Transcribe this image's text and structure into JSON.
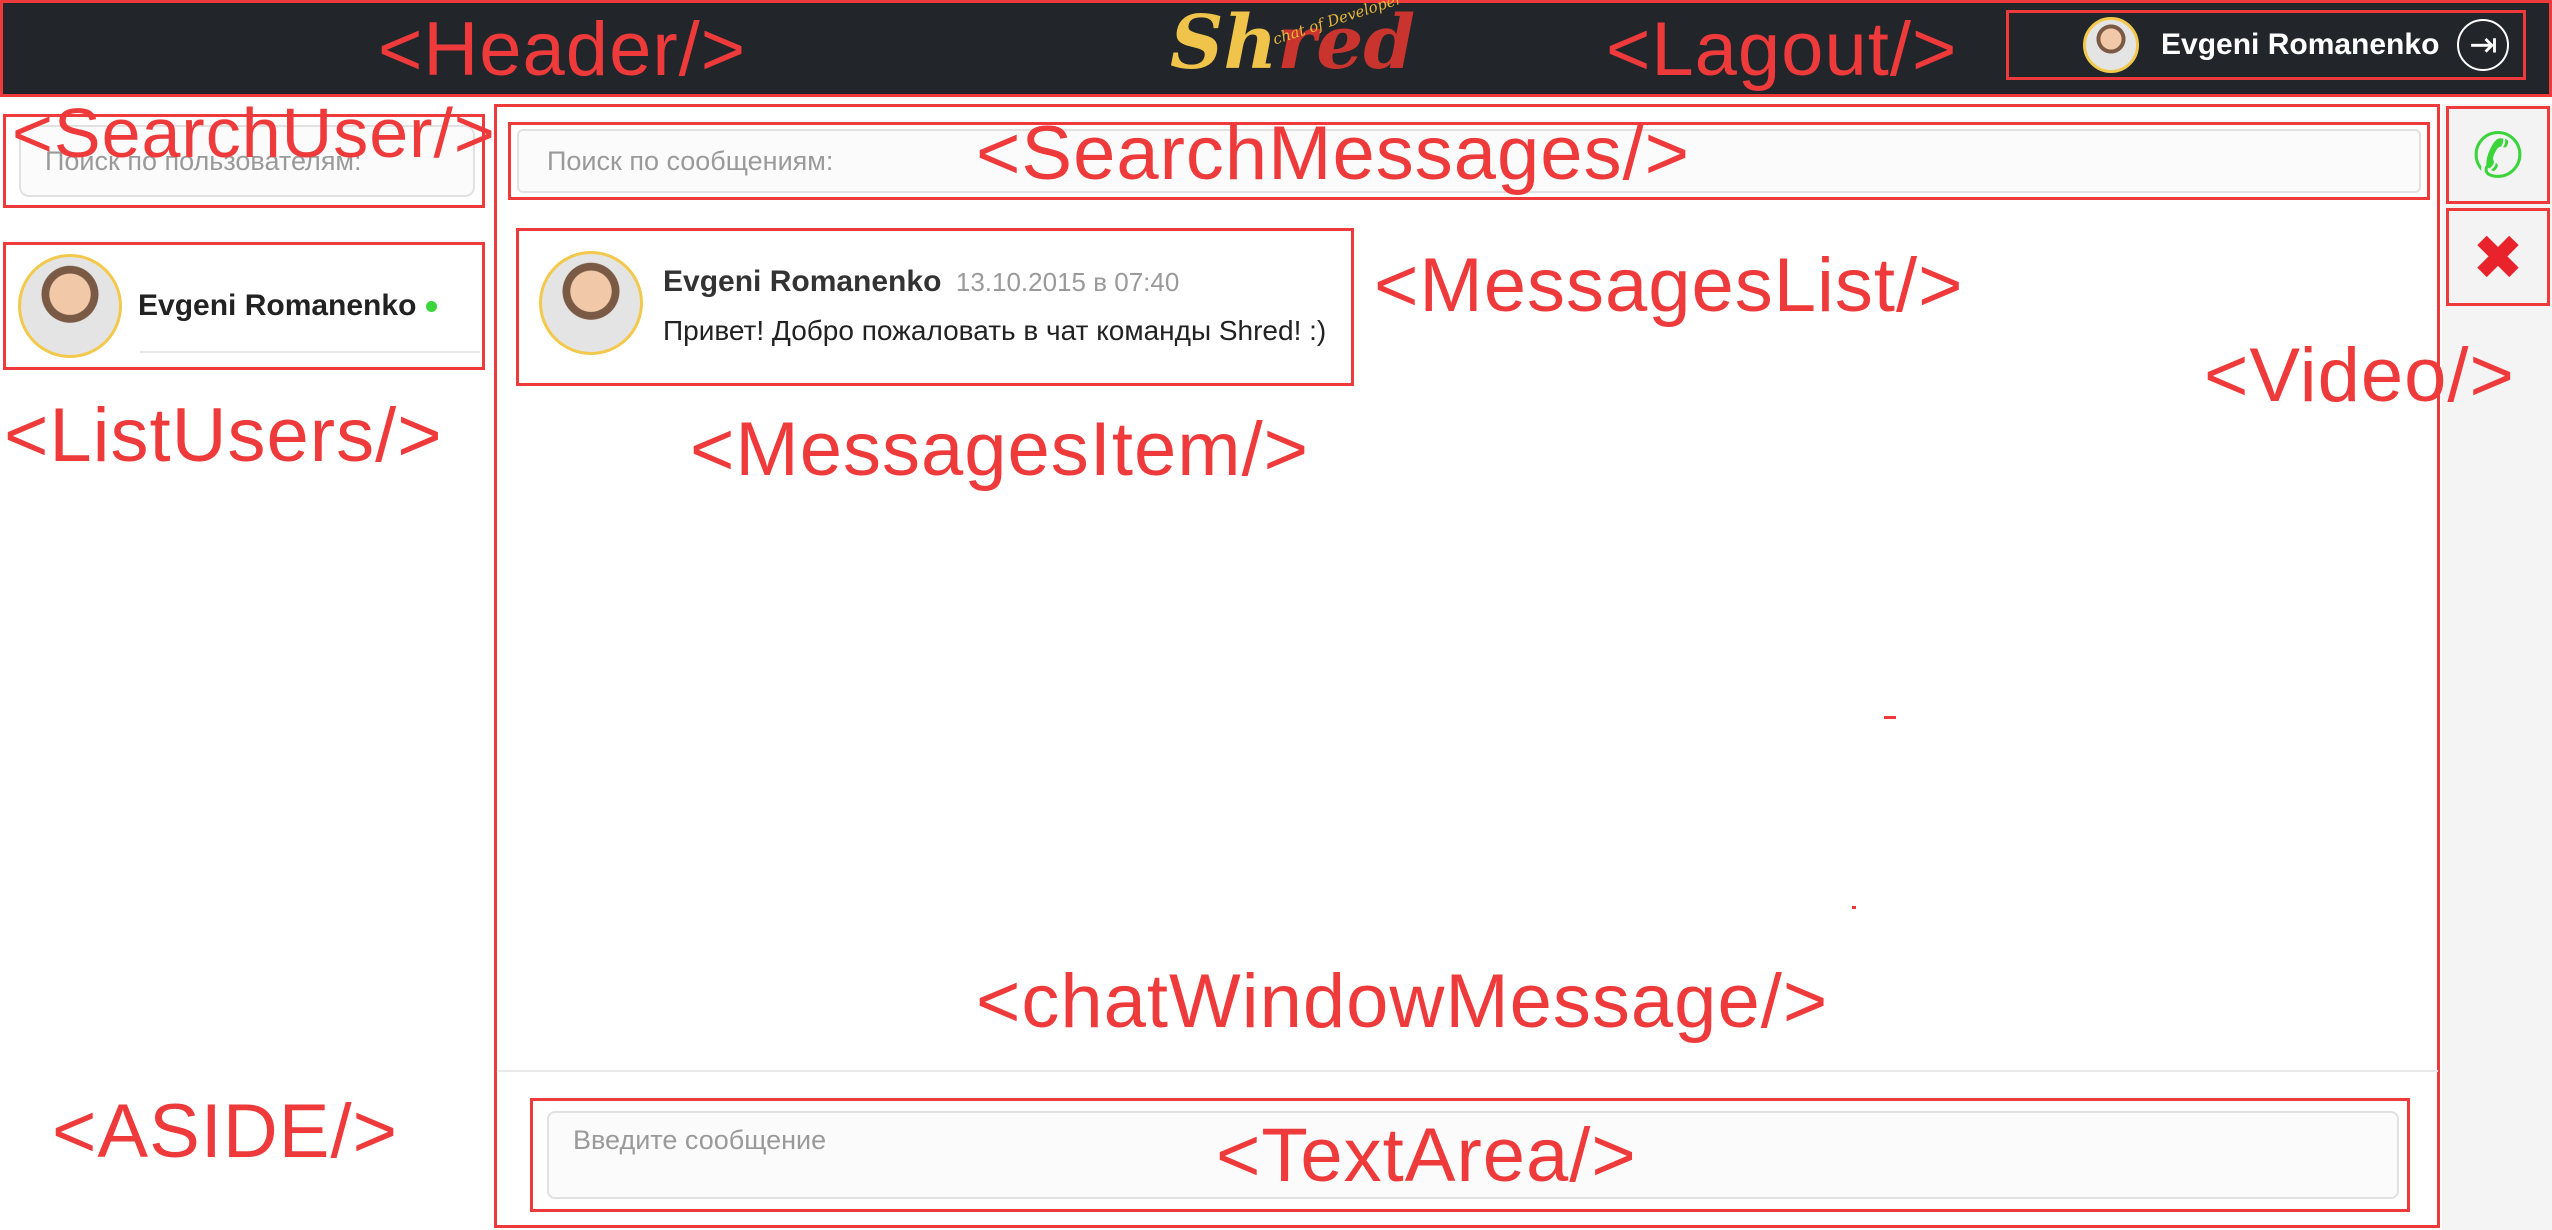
{
  "header": {
    "logo": "Shred",
    "logo_tagline": "chat of Developer",
    "user_name": "Evgeni Romanenko"
  },
  "aside": {
    "search_placeholder": "Поиск по пользователям:",
    "users": [
      {
        "name": "Evgeni Romanenko",
        "online": true
      }
    ]
  },
  "chat": {
    "search_placeholder": "Поиск по сообщениям:",
    "messages": [
      {
        "author": "Evgeni Romanenko",
        "time": "13.10.2015 в 07:40",
        "text": "Привет! Добро пожаловать в чат команды Shred! :)"
      }
    ],
    "input_placeholder": "Введите сообщение"
  },
  "video": {
    "call_icon": "phone-icon",
    "hangup_icon": "close-icon"
  },
  "annotations": {
    "header": "<Header/>",
    "logout": "<Lagout/>",
    "search_user": "<SearchUser/>",
    "search_messages": "<SearchMessages/>",
    "messages_list": "<MessagesList/>",
    "video": "<Video/>",
    "list_users": "<ListUsers/>",
    "messages_item": "<MessagesItem/>",
    "chat_window": "<chatWindowMessage/>",
    "aside": "<ASIDE/>",
    "textarea": "<TextArea/>"
  },
  "colors": {
    "header_bg": "#22262b",
    "annotation": "#ee3a3a",
    "logo_shr": "#f0c44a",
    "logo_ed": "#c9352e",
    "online": "#3bd43b",
    "call": "#3bd43b",
    "hangup": "#e8232b"
  }
}
